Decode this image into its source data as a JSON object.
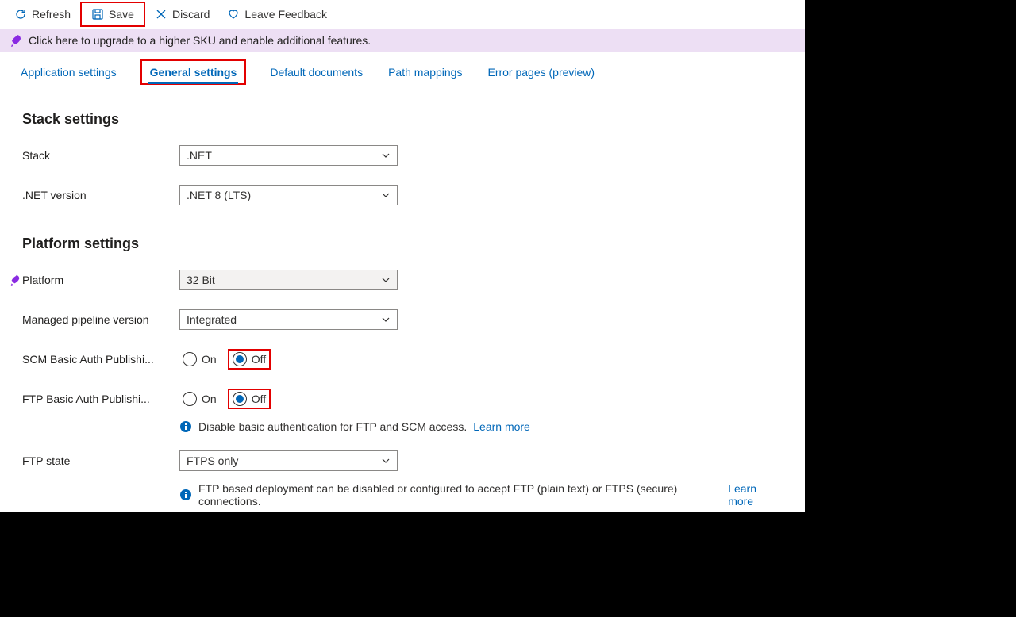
{
  "toolbar": {
    "refresh": "Refresh",
    "save": "Save",
    "discard": "Discard",
    "feedback": "Leave Feedback"
  },
  "banner": {
    "text": "Click here to upgrade to a higher SKU and enable additional features."
  },
  "tabs": {
    "app_settings": "Application settings",
    "general_settings": "General settings",
    "default_docs": "Default documents",
    "path_mappings": "Path mappings",
    "error_pages": "Error pages (preview)"
  },
  "sections": {
    "stack": "Stack settings",
    "platform": "Platform settings"
  },
  "fields": {
    "stack_label": "Stack",
    "stack_value": ".NET",
    "netversion_label": ".NET version",
    "netversion_value": ".NET 8 (LTS)",
    "platform_label": "Platform",
    "platform_value": "32 Bit",
    "pipeline_label": "Managed pipeline version",
    "pipeline_value": "Integrated",
    "scm_label": "SCM Basic Auth Publishi...",
    "ftp_label": "FTP Basic Auth Publishi...",
    "ftpstate_label": "FTP state",
    "ftpstate_value": "FTPS only"
  },
  "radios": {
    "on": "On",
    "off": "Off"
  },
  "info": {
    "basic_auth": "Disable basic authentication for FTP and SCM access.",
    "ftp_state": "FTP based deployment can be disabled or configured to accept FTP (plain text) or FTPS (secure) connections.",
    "learn_more": "Learn more"
  }
}
